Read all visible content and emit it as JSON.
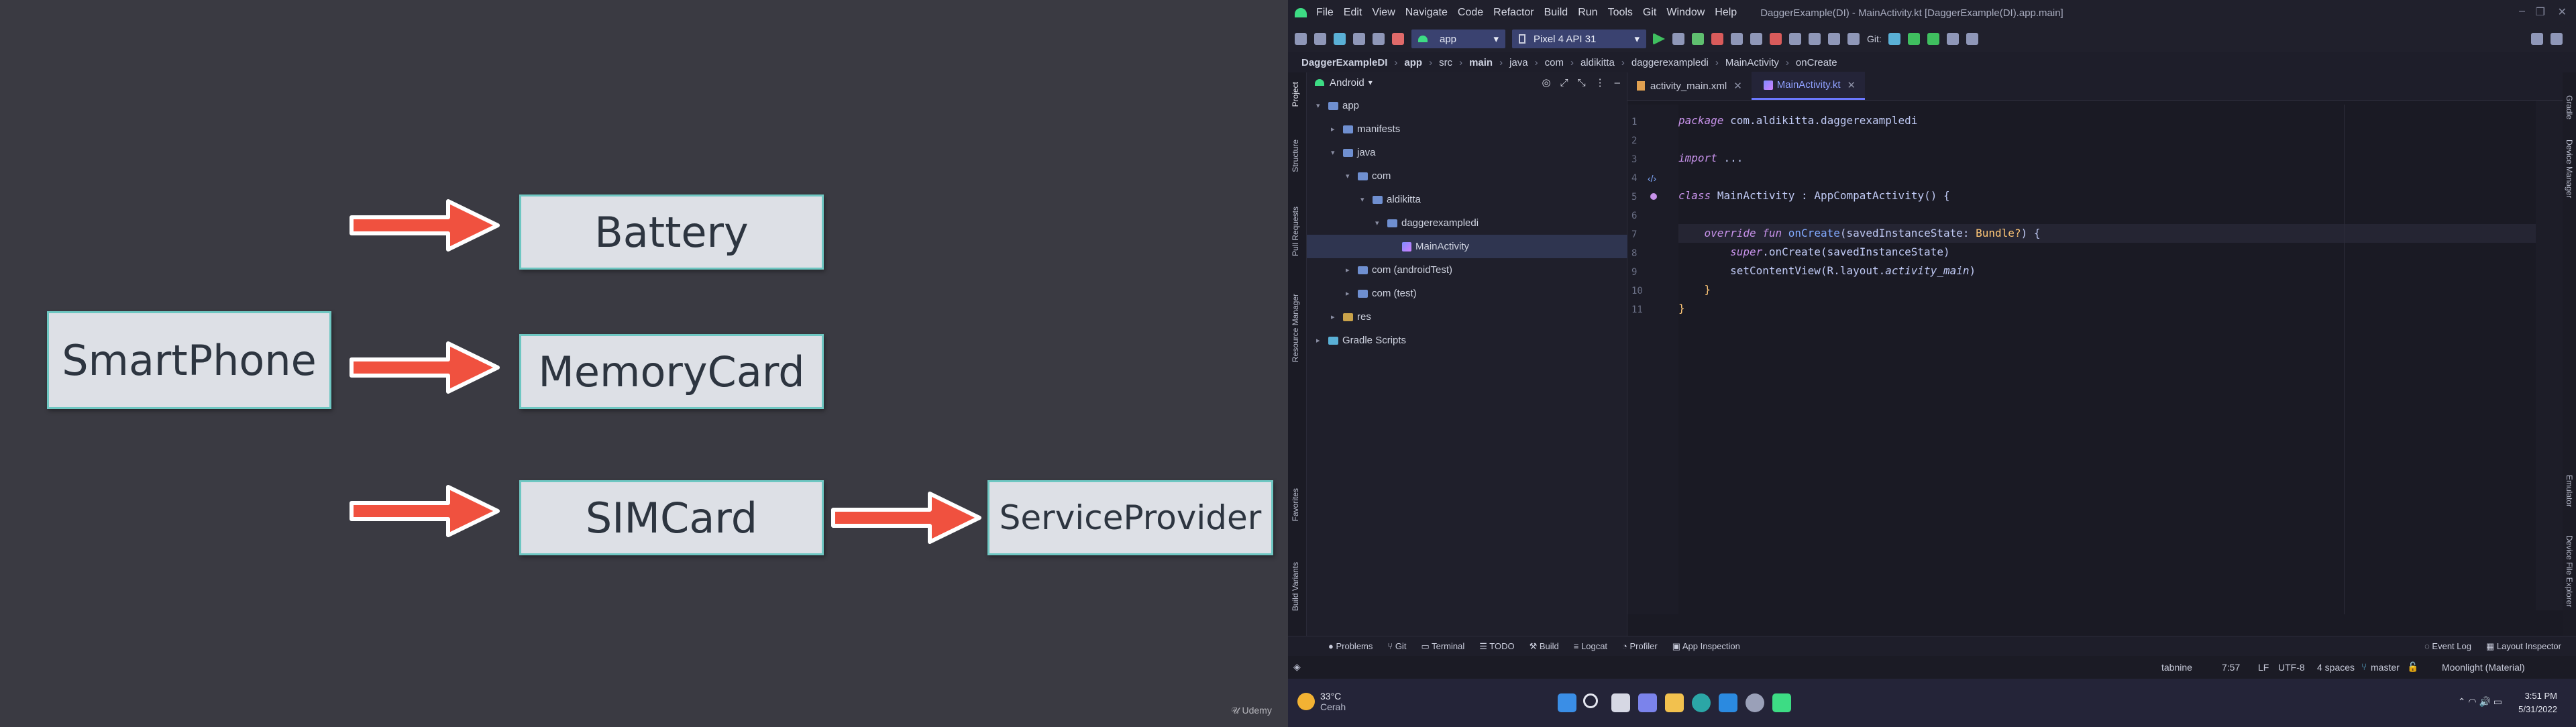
{
  "slide": {
    "nodes": {
      "smartphone": "SmartPhone",
      "battery": "Battery",
      "memorycard": "MemoryCard",
      "simcard": "SIMCard",
      "serviceprovider": "ServiceProvider"
    },
    "watermark": "Udemy",
    "colors": {
      "node_bg": "#dde0e6",
      "node_border": "#6ec7c2",
      "arrow": "#f0513f"
    }
  },
  "ide": {
    "menu": [
      "File",
      "Edit",
      "View",
      "Navigate",
      "Code",
      "Refactor",
      "Build",
      "Run",
      "Tools",
      "Git",
      "Window",
      "Help"
    ],
    "window_title": "DaggerExample(DI) - MainActivity.kt [DaggerExample(DI).app.main]",
    "toolbar": {
      "run_config": "app",
      "device": "Pixel 4 API 31",
      "git_label": "Git:"
    },
    "breadcrumb": [
      "DaggerExampleDI",
      "app",
      "src",
      "main",
      "java",
      "com",
      "aldikitta",
      "daggerexampledi",
      "MainActivity",
      "onCreate"
    ],
    "project_panel": {
      "view_selector": "Android"
    },
    "tree": [
      {
        "label": "app",
        "indent": 0,
        "type": "folder",
        "expanded": true
      },
      {
        "label": "manifests",
        "indent": 1,
        "type": "folder",
        "expanded": false
      },
      {
        "label": "java",
        "indent": 1,
        "type": "folder",
        "expanded": true
      },
      {
        "label": "com",
        "indent": 2,
        "type": "folder",
        "expanded": true
      },
      {
        "label": "aldikitta",
        "indent": 3,
        "type": "folder",
        "expanded": true
      },
      {
        "label": "daggerexampledi",
        "indent": 4,
        "type": "folder",
        "expanded": true
      },
      {
        "label": "MainActivity",
        "indent": 5,
        "type": "kotlin",
        "selected": true
      },
      {
        "label": "com (androidTest)",
        "indent": 2,
        "type": "folder",
        "expanded": false
      },
      {
        "label": "com (test)",
        "indent": 2,
        "type": "folder",
        "expanded": false
      },
      {
        "label": "res",
        "indent": 1,
        "type": "res",
        "expanded": false
      },
      {
        "label": "Gradle Scripts",
        "indent": 0,
        "type": "gradle",
        "expanded": false
      }
    ],
    "tabs": [
      {
        "label": "activity_main.xml",
        "active": false
      },
      {
        "label": "MainActivity.kt",
        "active": true
      }
    ],
    "code": {
      "line_numbers": [
        "1",
        "2",
        "3",
        "4",
        "5",
        "6",
        "7",
        "8",
        "9",
        "10",
        "11"
      ],
      "package_kw": "package",
      "package_name": "com.aldikitta.daggerexampledi",
      "import_kw": "import",
      "import_fold": "...",
      "class_kw": "class",
      "class_name": "MainActivity",
      "class_colon": ":",
      "class_parent": "AppCompatActivity",
      "class_tail": "() {",
      "override_kw": "override",
      "fun_kw": "fun",
      "fun_name": "onCreate",
      "fun_params": "(savedInstanceState: ",
      "fun_type": "Bundle?",
      "fun_tail": ") {",
      "super_kw": "super",
      "super_call": ".onCreate(savedInstanceState)",
      "setcontent": "setContentView(R.layout.",
      "layout_name": "activity_main",
      "setcontent_tail": ")",
      "close_inner": "}",
      "close_outer": "}"
    },
    "left_tabs": [
      "Project",
      "Structure",
      "Pull Requests",
      "Resource Manager",
      "Favorites",
      "Build Variants"
    ],
    "right_tabs": [
      "Gradle",
      "Device Manager",
      "Emulator",
      "Device File Explorer"
    ],
    "bottom_tools": [
      "Problems",
      "Git",
      "Terminal",
      "TODO",
      "Build",
      "Logcat",
      "Profiler",
      "App Inspection"
    ],
    "bottom_right_tools": [
      "Event Log",
      "Layout Inspector"
    ],
    "status": {
      "tabnine": "tabnine",
      "position": "7:57",
      "line_ending": "LF",
      "encoding": "UTF-8",
      "indent": "4 spaces",
      "branch": "master",
      "theme": "Moonlight (Material)"
    }
  },
  "taskbar": {
    "weather_temp": "33°C",
    "weather_text": "Cerah",
    "time": "3:51 PM",
    "date": "5/31/2022"
  }
}
